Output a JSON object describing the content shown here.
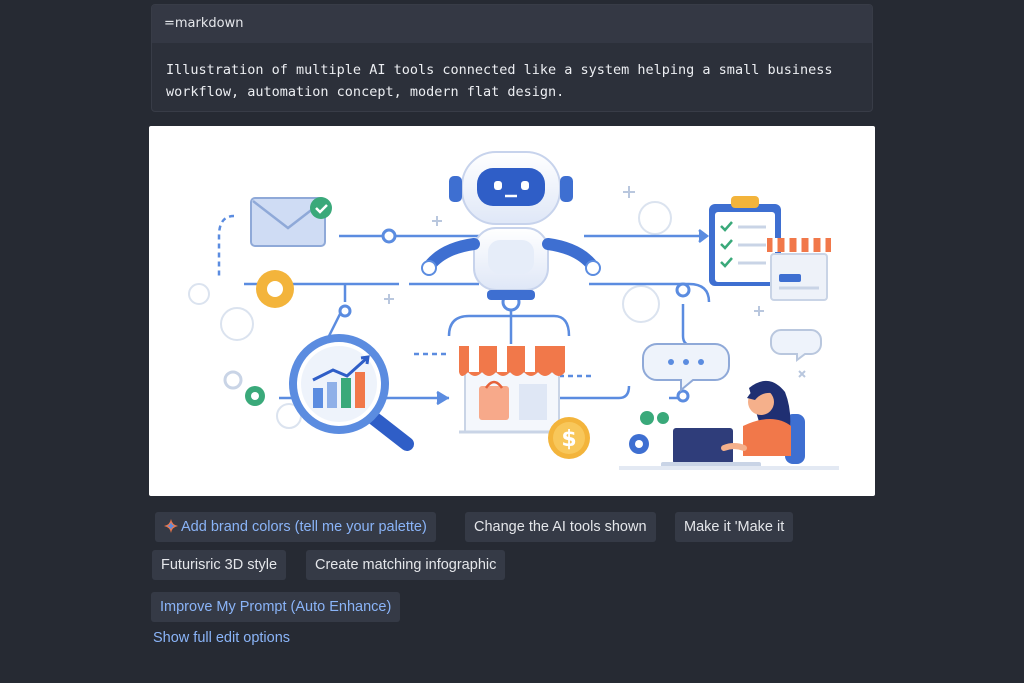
{
  "code_block": {
    "language": "=markdown",
    "text": "Illustration of multiple AI tools connected like a system helping a small business\nworkflow, automation concept, modern flat design."
  },
  "image": {
    "price_symbol": "$"
  },
  "suggestions": {
    "brand_colors": "Add brand colors (tell me your palette)",
    "change_tools": "Change the AI tools shown",
    "make_it": "Make it 'Make it",
    "futuristic": "Futurisric 3D style",
    "infographic": "Create matching infographic",
    "improve_prompt": "Improve My Prompt (Auto Enhance)"
  },
  "show_full_edit": "Show full edit options",
  "colors": {
    "background": "#262a33",
    "chip_bg": "#353a46",
    "accent": "#8ab4f8",
    "illustration_blue": "#3e6fd1",
    "illustration_orange": "#f1784a"
  }
}
